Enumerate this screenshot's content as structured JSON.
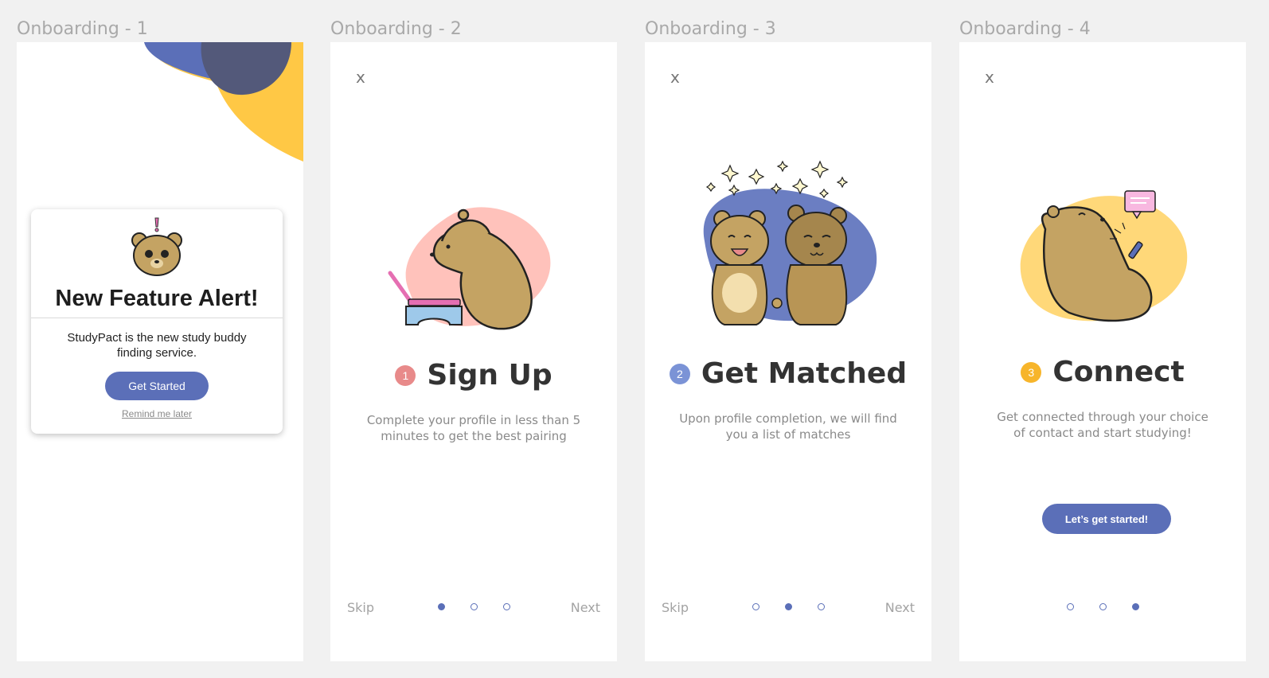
{
  "frames": [
    {
      "label": "Onboarding - 1",
      "modal": {
        "title": "New Feature Alert!",
        "body": "StudyPact is the new study buddy finding service.",
        "primary_label": "Get Started",
        "secondary_label": "Remind me later"
      },
      "colors": {
        "blob_blue": "#5b6fb8",
        "blob_dark": "#53597a",
        "blob_yellow": "#ffc845"
      }
    },
    {
      "label": "Onboarding - 2",
      "close": "x",
      "step_number": "1",
      "title": "Sign Up",
      "description": "Complete your profile in less than 5 minutes to get the best pairing",
      "skip": "Skip",
      "next": "Next",
      "active_dot": 1,
      "colors": {
        "badge": "#e88a8a",
        "blob": "#ffc2bb"
      }
    },
    {
      "label": "Onboarding - 3",
      "close": "x",
      "step_number": "2",
      "title": "Get Matched",
      "description": "Upon profile completion, we will find you a list of matches",
      "skip": "Skip",
      "next": "Next",
      "active_dot": 2,
      "colors": {
        "badge": "#7b93d6",
        "blob": "#6b7ec2"
      }
    },
    {
      "label": "Onboarding - 4",
      "close": "x",
      "step_number": "3",
      "title": "Connect",
      "description": "Get connected through your choice of contact and start studying!",
      "cta": "Let’s get started!",
      "active_dot": 3,
      "colors": {
        "badge": "#f7b52b",
        "blob": "#ffd879"
      }
    }
  ],
  "colors": {
    "accent": "#5b6fb8",
    "background": "#f1f1f1",
    "bear": "#c4a363",
    "bear_dark": "#a5864d"
  }
}
